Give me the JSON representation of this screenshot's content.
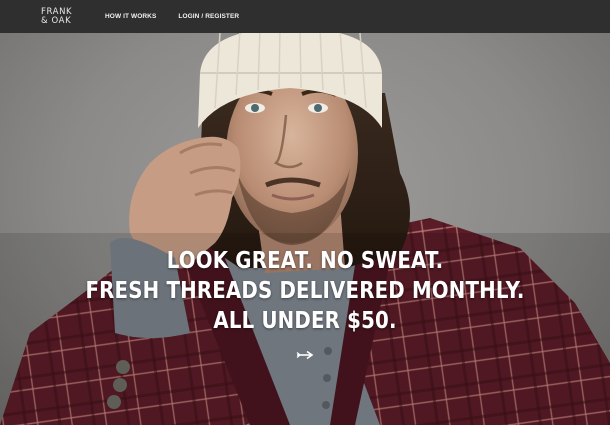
{
  "header": {
    "logo_line1": "FRANK",
    "logo_line2": "& OAK",
    "nav": [
      {
        "label": "HOW IT WORKS"
      },
      {
        "label": "LOGIN / REGISTER"
      }
    ]
  },
  "hero": {
    "headline": [
      "LOOK GREAT. NO SWEAT.",
      "FRESH THREADS DELIVERED MONTHLY.",
      "ALL UNDER $50."
    ],
    "scroll_icon": "arrow-right-icon"
  },
  "colors": {
    "topbar": "#2f2f2f",
    "jacket": "#5e1f2a",
    "beanie": "#ede7da",
    "shirt": "#7f8790"
  }
}
